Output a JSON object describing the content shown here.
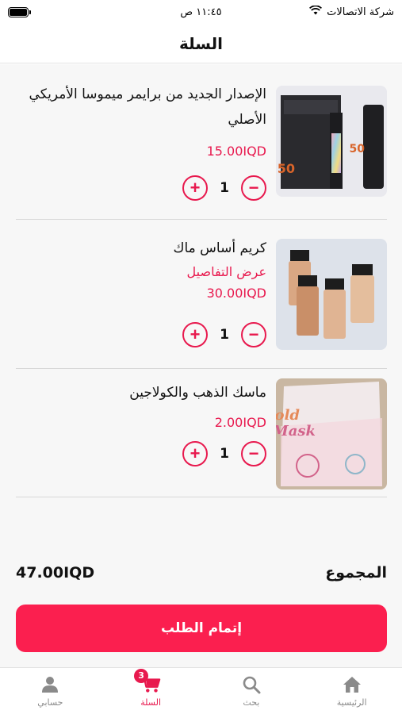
{
  "status_bar": {
    "carrier": "شركة الاتصالات",
    "time": "١١:٤٥ ص"
  },
  "header": {
    "title": "السلة"
  },
  "cart": {
    "items": [
      {
        "name": "الإصدار الجديد من برايمر ميموسا الأمريكي الأصلي",
        "details_link": "",
        "price": "15.00IQD",
        "quantity": "1",
        "image": "primer-product-image"
      },
      {
        "name": "كريم أساس ماك",
        "details_link": "عرض التفاصيل",
        "price": "30.00IQD",
        "quantity": "1",
        "image": "foundation-product-image"
      },
      {
        "name": "ماسك الذهب والكولاجين",
        "details_link": "",
        "price": "2.00IQD",
        "quantity": "1",
        "image": "gold-mask-product-image"
      }
    ],
    "total_label": "المجموع",
    "total_value": "47.00IQD",
    "checkout_label": "إتمام الطلب"
  },
  "tabbar": {
    "tabs": [
      {
        "label": "الرئيسية",
        "icon": "home-icon"
      },
      {
        "label": "بحث",
        "icon": "search-icon"
      },
      {
        "label": "السلة",
        "icon": "cart-icon",
        "badge": "3",
        "active": true
      },
      {
        "label": "حسابي",
        "icon": "person-icon"
      }
    ]
  },
  "colors": {
    "accent": "#e8194e",
    "checkout_bg": "#fb1f4f",
    "content_bg": "#f7f7f7"
  }
}
